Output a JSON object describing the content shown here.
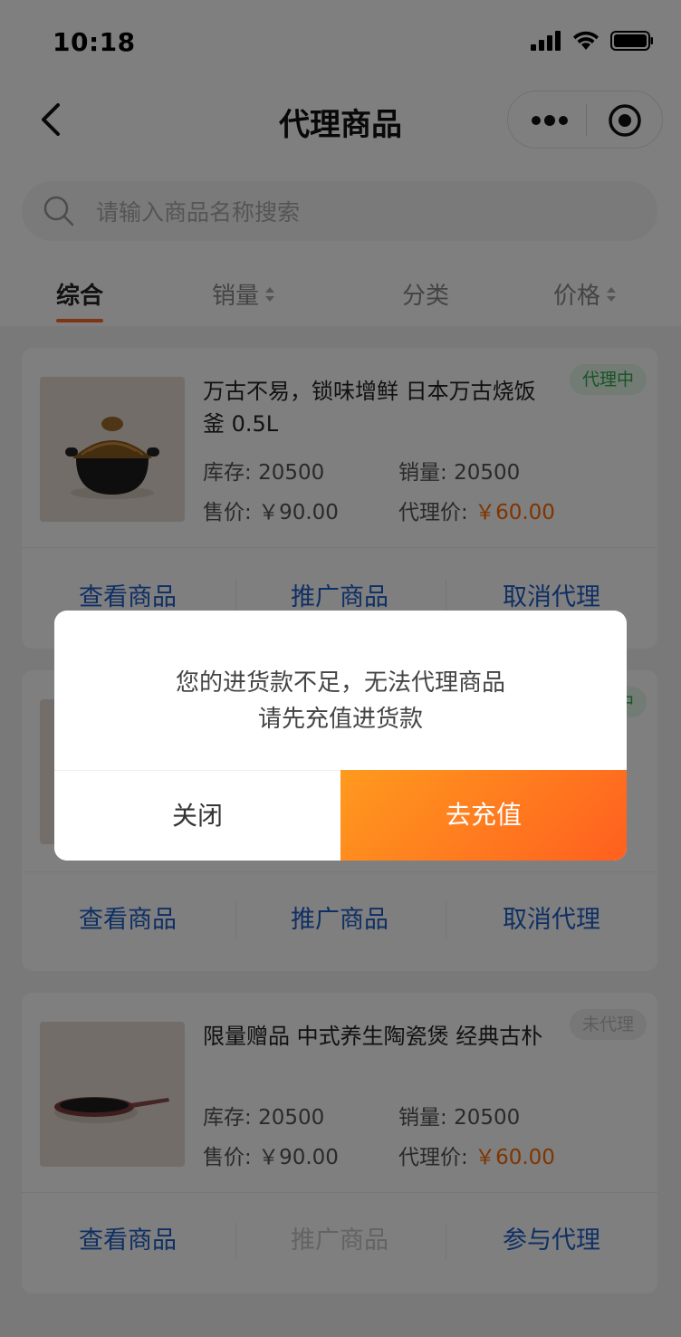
{
  "status_bar": {
    "time": "10:18"
  },
  "nav": {
    "title": "代理商品"
  },
  "search": {
    "placeholder": "请输入商品名称搜索"
  },
  "tabs": [
    {
      "label": "综合",
      "active": true,
      "sortable": false
    },
    {
      "label": "销量",
      "active": false,
      "sortable": true
    },
    {
      "label": "分类",
      "active": false,
      "sortable": false
    },
    {
      "label": "价格",
      "active": false,
      "sortable": true
    }
  ],
  "products": [
    {
      "title": "万古不易，锁味增鲜 日本万古烧饭釜 0.5L",
      "badge": "代理中",
      "stock_label": "库存:",
      "stock": "20500",
      "sales_label": "销量:",
      "sales": "20500",
      "price_label": "售价:",
      "price": "￥90.00",
      "agent_price_label": "代理价:",
      "agent_price": "￥60.00",
      "actions": [
        "查看商品",
        "推广商品",
        "取消代理"
      ]
    },
    {
      "title": "",
      "badge": "代理中",
      "actions": [
        "查看商品",
        "推广商品",
        "取消代理"
      ]
    },
    {
      "title": "限量赠品 中式养生陶瓷煲 经典古朴",
      "badge": "未代理",
      "stock_label": "库存:",
      "stock": "20500",
      "sales_label": "销量:",
      "sales": "20500",
      "price_label": "售价:",
      "price": "￥90.00",
      "agent_price_label": "代理价:",
      "agent_price": "￥60.00",
      "actions": [
        "查看商品",
        "推广商品",
        "参与代理"
      ]
    }
  ],
  "dialog": {
    "line1": "您的进货款不足，无法代理商品",
    "line2": "请先充值进货款",
    "close_label": "关闭",
    "recharge_label": "去充值"
  },
  "colors": {
    "accent_orange": "#ff6a00",
    "link_blue": "#1f5fc8",
    "badge_green": "#2fa84a"
  }
}
